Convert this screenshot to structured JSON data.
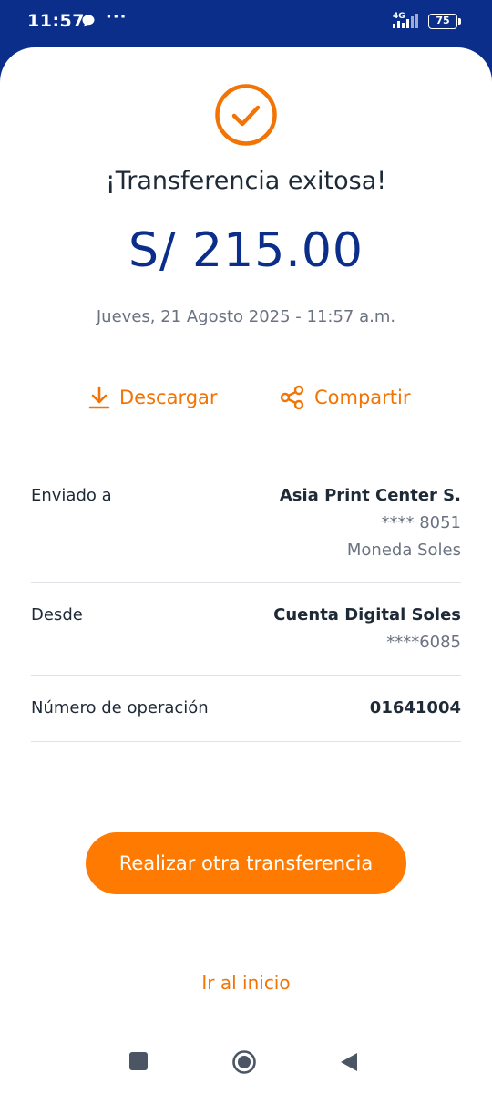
{
  "status_bar": {
    "time": "11:57",
    "dots": "···",
    "network": "4G",
    "battery": "75",
    "icons": [
      "chat-bubble-icon",
      "signal-icon",
      "battery-icon"
    ]
  },
  "receipt": {
    "icon": "check-circle-icon",
    "title": "¡Transferencia exitosa!",
    "amount": "S/ 215.00",
    "datetime": "Jueves, 21 Agosto 2025 - 11:57 a.m."
  },
  "actions": {
    "download_label": "Descargar",
    "download_icon": "download-icon",
    "share_label": "Compartir",
    "share_icon": "share-icon"
  },
  "details": {
    "sent_to": {
      "label": "Enviado a",
      "name": "Asia Print Center S.",
      "account": "**** 8051",
      "currency": "Moneda Soles"
    },
    "from": {
      "label": "Desde",
      "account_name": "Cuenta Digital Soles",
      "account_number": "****6085"
    },
    "operation": {
      "label": "Número de operación",
      "value": "01641004"
    }
  },
  "buttons": {
    "primary": "Realizar otra transferencia",
    "home_link": "Ir al inicio"
  },
  "nav": {
    "icons": [
      "recents-icon",
      "home-icon",
      "back-icon"
    ]
  },
  "colors": {
    "brand_blue": "#0a2e8a",
    "accent_orange": "#ff7a00",
    "text_dark": "#1f2a37",
    "text_muted": "#6b7280",
    "divider": "#dfe3e8"
  }
}
